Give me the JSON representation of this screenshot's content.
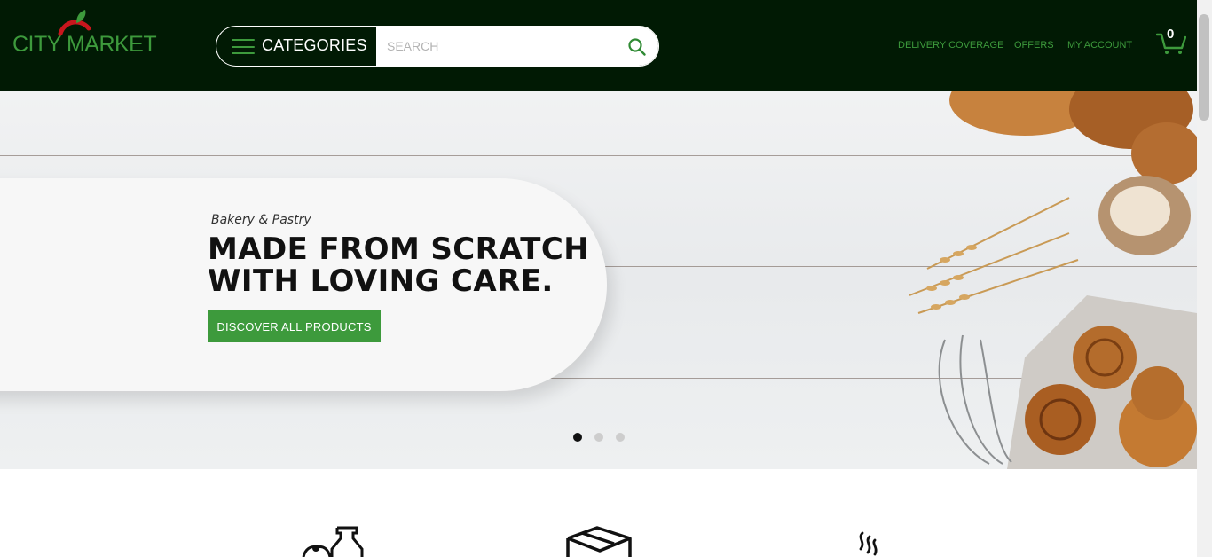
{
  "header": {
    "logo_text": "CITY MARKET",
    "categories_label": "CATEGORIES",
    "search_placeholder": "SEARCH",
    "nav": {
      "delivery": "DELIVERY COVERAGE",
      "offers": "OFFERS",
      "account": "MY ACCOUNT"
    },
    "cart_count": "0"
  },
  "hero": {
    "kicker": "Bakery & Pastry",
    "title_line1": "MADE FROM SCRATCH",
    "title_line2": "WITH LOVING CARE.",
    "cta": "DISCOVER ALL PRODUCTS",
    "slides": 3,
    "active_slide": 1
  },
  "features": {
    "icons": [
      "milk-bottle-icon",
      "box-icon",
      "steam-icon"
    ]
  },
  "colors": {
    "header_bg": "#011a04",
    "brand_green": "#3d9a3c",
    "apple_red": "#c8161d"
  }
}
